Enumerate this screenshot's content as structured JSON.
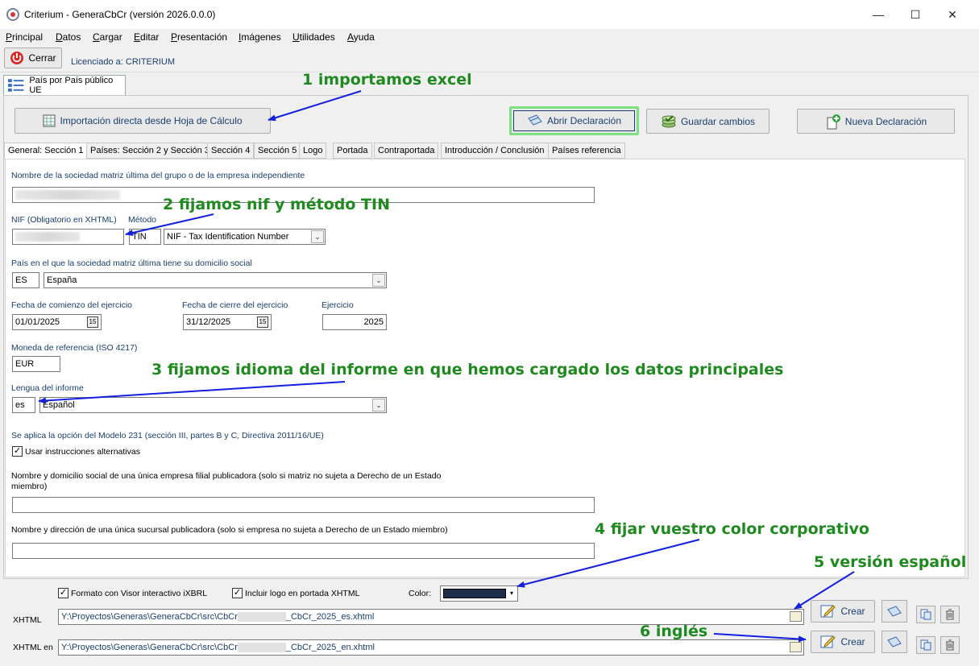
{
  "window": {
    "title": "Criterium - GeneraCbCr (versión 2026.0.0.0)",
    "minimize": "—",
    "maximize": "☐",
    "close": "✕"
  },
  "menu": [
    "Principal",
    "Datos",
    "Cargar",
    "Editar",
    "Presentación",
    "Imágenes",
    "Utilidades",
    "Ayuda"
  ],
  "menu_accel": [
    "P",
    "D",
    "C",
    "E",
    "P",
    "I",
    "U",
    "A"
  ],
  "toolbar": {
    "close_label": "Cerrar",
    "license": "Licenciado a: CRITERIUM"
  },
  "doc_tab": "País por País público UE",
  "actions": {
    "import": "Importación directa desde Hoja de Cálculo",
    "open": "Abrir Declaración",
    "save": "Guardar cambios",
    "new": "Nueva Declaración"
  },
  "tabs": [
    "General: Sección 1",
    "Países: Sección 2 y Sección 3",
    "Sección 4",
    "Sección 5",
    "Logo",
    "Portada",
    "Contraportada",
    "Introducción / Conclusión",
    "Países referencia"
  ],
  "form": {
    "parent_name_label": "Nombre de la sociedad matriz última del grupo o de la empresa independiente",
    "nif_label": "NIF (Obligatorio en XHTML)",
    "method_label": "Método",
    "method_code": "TIN",
    "method_value": "NIF - Tax Identification Number",
    "country_label": "País en el que la sociedad matriz última tiene su domicilio social",
    "country_code": "ES",
    "country_value": "España",
    "start_label": "Fecha de comienzo del ejercicio",
    "start_value": "01/01/2025",
    "end_label": "Fecha de cierre del ejercicio",
    "end_value": "31/12/2025",
    "year_label": "Ejercicio",
    "year_value": "2025",
    "currency_label": "Moneda de referencia (ISO 4217)",
    "currency_value": "EUR",
    "lang_label": "Lengua del informe",
    "lang_code": "es",
    "lang_value": "Español",
    "option_label": "Se aplica la opción del Modelo 231 (sección III, partes B y C, Directiva 2011/16/UE)",
    "alt_instr_label": "Usar instrucciones alternativas",
    "subsidiary_label": "Nombre y domicilio social de una única empresa filial publicadora (solo si matriz no sujeta a Derecho de un Estado miembro)",
    "branch_label": "Nombre y dirección de una única sucursal publicadora (solo si empresa no sujeta a Derecho de un Estado miembro)"
  },
  "bottom": {
    "ixbrl_label": "Formato con Visor interactivo iXBRL",
    "logo_label": "Incluir logo en portada XHTML",
    "color_label": "Color:",
    "corp_color": "#1c2e4a",
    "xhtml_label": "XHTML",
    "xhtml_en_label": "XHTML en",
    "path_es_start": "Y:\\Proyectos\\Generas\\GeneraCbCr\\src\\CbCr",
    "path_es_end": "_CbCr_2025_es.xhtml",
    "path_en_start": "Y:\\Proyectos\\Generas\\GeneraCbCr\\src\\CbCr",
    "path_en_end": "_CbCr_2025_en.xhtml",
    "create_label": "Crear"
  },
  "annotations": {
    "a1": "1 importamos excel",
    "a2": "2 fijamos nif y método TIN",
    "a3": "3 fijamos idioma del informe en que hemos cargado los datos principales",
    "a4": "4 fijar vuestro color corporativo",
    "a5": "5 versión español",
    "a6": "6 inglés"
  }
}
